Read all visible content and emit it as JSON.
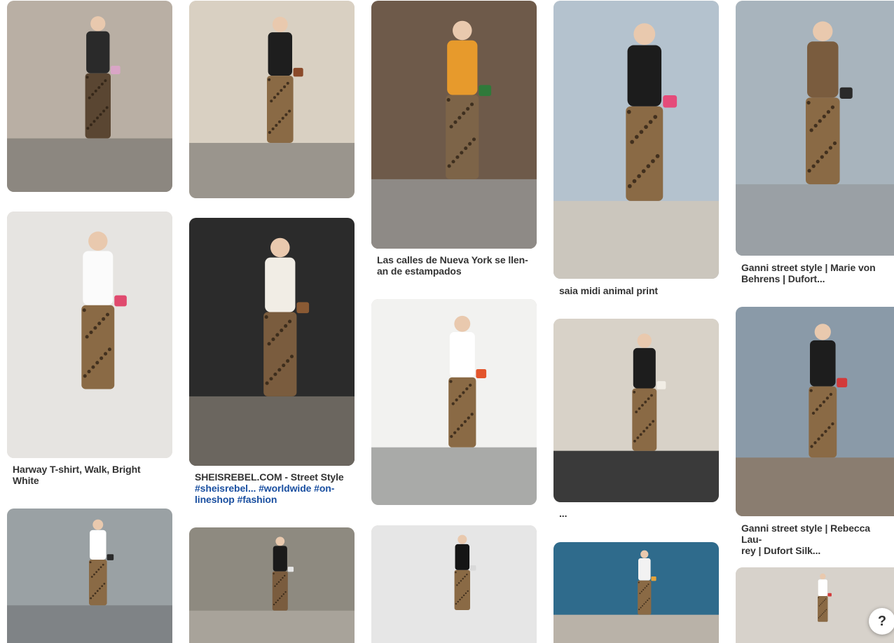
{
  "pins": [
    {
      "id": "p1",
      "title_lines": [],
      "scene": {
        "bg": "#b9afa4",
        "ground": "#8c8780",
        "top": "#2a2a2a",
        "bottom": "#5a4632",
        "accent": "#d9a5c6"
      }
    },
    {
      "id": "p2",
      "title_lines": [],
      "scene": {
        "bg": "#d9d0c2",
        "ground": "#9a958d",
        "top": "#1e1e1e",
        "bottom": "#8a6a45",
        "accent": "#8b4a2a"
      }
    },
    {
      "id": "p3",
      "title_lines": [
        "Las calles de Nueva York se llen-",
        "an de estampados"
      ],
      "scene": {
        "bg": "#6e5a4a",
        "ground": "#8e8a86",
        "top": "#e79a2c",
        "bottom": "#7d6448",
        "accent": "#2f7a3a"
      }
    },
    {
      "id": "p4",
      "title_lines": [
        "saia midi animal print"
      ],
      "scene": {
        "bg": "#b4c2ce",
        "ground": "#cbc6bd",
        "top": "#1c1c1c",
        "bottom": "#8a6a45",
        "accent": "#e54b7a"
      }
    },
    {
      "id": "p5",
      "title_lines": [
        "Ganni street style | Marie von",
        "Behrens | Dufort..."
      ],
      "scene": {
        "bg": "#a8b4bd",
        "ground": "#9aa0a5",
        "top": "#7a5c3e",
        "bottom": "#8a6a45",
        "accent": "#2a2a2a"
      }
    },
    {
      "id": "p6",
      "title_lines": [
        "Harway T-shirt, Walk, Bright",
        "White"
      ],
      "scene": {
        "bg": "#e6e4e1",
        "ground": "#e6e4e1",
        "top": "#fbfbfb",
        "bottom": "#8a6a45",
        "accent": "#e04a6e"
      }
    },
    {
      "id": "p7",
      "title_lines": [
        "SHEISREBEL.COM - Street Style"
      ],
      "title_tags": [
        "#sheisrebel... #worldwide #on-",
        "lineshop #fashion"
      ],
      "scene": {
        "bg": "#2b2b2b",
        "ground": "#6b665f",
        "top": "#f1ede5",
        "bottom": "#7a5c3e",
        "accent": "#8a5a34"
      }
    },
    {
      "id": "p8",
      "title_lines": [],
      "scene": {
        "bg": "#f2f2f0",
        "ground": "#a9aaa8",
        "top": "#ffffff",
        "bottom": "#8a6a45",
        "accent": "#e3552c"
      }
    },
    {
      "id": "p9",
      "title_lines": [
        "..."
      ],
      "scene": {
        "bg": "#d8d2c8",
        "ground": "#3a3a3a",
        "top": "#1d1d1d",
        "bottom": "#8a6a45",
        "accent": "#f1ede5"
      }
    },
    {
      "id": "p10",
      "title_lines": [
        "Ganni street style | Rebecca Lau-",
        "rey | Dufort Silk..."
      ],
      "scene": {
        "bg": "#8a9aa8",
        "ground": "#8a7d70",
        "top": "#1d1d1d",
        "bottom": "#8a6a45",
        "accent": "#d23a3a"
      }
    },
    {
      "id": "p11",
      "title_lines": [],
      "scene": {
        "bg": "#9aa1a4",
        "ground": "#7f8386",
        "top": "#ffffff",
        "bottom": "#8a6a45",
        "accent": "#2a2a2a"
      }
    },
    {
      "id": "p12",
      "title_lines": [],
      "scene": {
        "bg": "#8e8a80",
        "ground": "#a8a39a",
        "top": "#1a1a1a",
        "bottom": "#7a5c3e",
        "accent": "#e6e6e6"
      }
    },
    {
      "id": "p13",
      "title_lines": [],
      "scene": {
        "bg": "#e6e6e6",
        "ground": "#e6e6e6",
        "top": "#151515",
        "bottom": "#8a6a45",
        "accent": "#d9d9d9"
      }
    },
    {
      "id": "p14",
      "title_lines": [],
      "scene": {
        "bg": "#2f6b8c",
        "ground": "#b9b2a8",
        "top": "#f2f2f2",
        "bottom": "#8a6a45",
        "accent": "#e6a33a"
      }
    },
    {
      "id": "p15",
      "title_lines": [],
      "scene": {
        "bg": "#d7d2cb",
        "ground": "#d7d2cb",
        "top": "#ffffff",
        "bottom": "#8a6a45",
        "accent": "#d23a3a"
      }
    }
  ],
  "help": {
    "label": "?"
  }
}
